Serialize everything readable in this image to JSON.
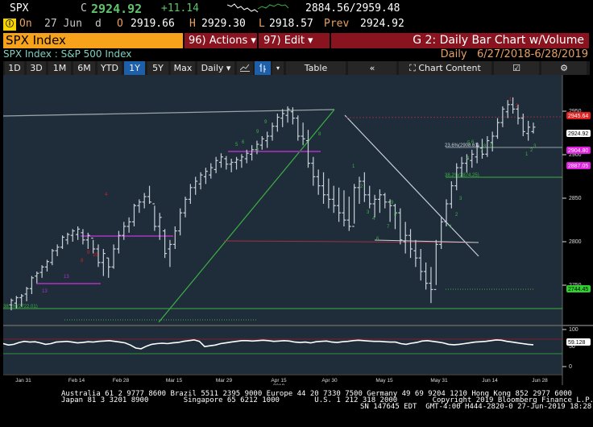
{
  "quote": {
    "ticker": "SPX",
    "close_label": "C",
    "close": "2924.92",
    "change": "+11.14",
    "range_low_high": "2884.56/2959.48",
    "on_label": "On",
    "date": "27 Jun",
    "d_label": "d",
    "open_label": "O",
    "open": "2919.66",
    "high_label": "H",
    "high": "2929.30",
    "low_label": "L",
    "low": "2918.57",
    "prev_label": "Prev",
    "prev": "2924.92",
    "icon": "alert-icon"
  },
  "toolbar_top": {
    "security": "SPX Index",
    "actions": "96) Actions ▾",
    "edit": "97) Edit ▾",
    "title": "G 2: Daily Bar Chart w/Volume"
  },
  "subheader": {
    "description": "SPX Index : S&P 500 Index",
    "period_label": "Daily",
    "range": "6/27/2018-6/28/2019"
  },
  "toolbar": {
    "periods": [
      "1D",
      "3D",
      "1M",
      "6M",
      "YTD",
      "1Y",
      "5Y",
      "Max"
    ],
    "active_period": "1Y",
    "frequency": "Daily ▾",
    "table": "Table",
    "collapse": "«",
    "chart_content": "Chart Content",
    "edit_icon": "edit-icon",
    "settings_icon": "gear-icon"
  },
  "colors": {
    "chart_bg": "#1f2d3a",
    "bars": "#c8d0d8",
    "green": "#3cb043",
    "red": "#d42020",
    "magenta": "#b030c0",
    "orange": "#f7a21b",
    "dark_red": "#8a1320"
  },
  "chart_data": {
    "type": "bar",
    "title": "G 2: Daily Bar Chart w/Volume",
    "series": "SPX Index",
    "ylim": [
      2715,
      2965
    ],
    "y_ticks": [
      "2950",
      "2900",
      "2850",
      "2800",
      "2750"
    ],
    "x_ticks": [
      "Jan 31",
      "Feb 14",
      "Feb 28",
      "Mar 15",
      "Mar 29",
      "Apr 15",
      "Apr 30",
      "May 15",
      "May 31",
      "Jun 14",
      "Jun 28"
    ],
    "x_year": "2019",
    "price_labels": [
      {
        "value": "2945.64",
        "color": "#e02020"
      },
      {
        "value": "2924.92",
        "color": "#ffffff"
      },
      {
        "value": "2904.80",
        "color": "#e020e0"
      },
      {
        "value": "2887.05",
        "color": "#e020e0"
      },
      {
        "value": "2744.45",
        "color": "#30d030"
      }
    ],
    "fib_labels": [
      "23.6%(2908.61)",
      "38.2%(2874.25)",
      "38.2%(2722.01)"
    ],
    "bars": [
      [
        2735,
        2722,
        2728,
        2733
      ],
      [
        2738,
        2724,
        2730,
        2736
      ],
      [
        2740,
        2726,
        2736,
        2738
      ],
      [
        2748,
        2732,
        2740,
        2746
      ],
      [
        2760,
        2740,
        2746,
        2758
      ],
      [
        2765,
        2752,
        2760,
        2763
      ],
      [
        2772,
        2758,
        2764,
        2770
      ],
      [
        2778,
        2765,
        2770,
        2776
      ],
      [
        2790,
        2772,
        2775,
        2788
      ],
      [
        2795,
        2782,
        2788,
        2792
      ],
      [
        2805,
        2790,
        2792,
        2803
      ],
      [
        2808,
        2795,
        2800,
        2806
      ],
      [
        2812,
        2798,
        2805,
        2810
      ],
      [
        2815,
        2800,
        2806,
        2812
      ],
      [
        2812,
        2795,
        2808,
        2800
      ],
      [
        2808,
        2790,
        2800,
        2805
      ],
      [
        2800,
        2785,
        2802,
        2790
      ],
      [
        2795,
        2770,
        2790,
        2775
      ],
      [
        2790,
        2760,
        2775,
        2785
      ],
      [
        2780,
        2758,
        2780,
        2770
      ],
      [
        2795,
        2768,
        2770,
        2790
      ],
      [
        2810,
        2785,
        2790,
        2805
      ],
      [
        2820,
        2800,
        2805,
        2815
      ],
      [
        2825,
        2808,
        2815,
        2820
      ],
      [
        2840,
        2815,
        2820,
        2838
      ],
      [
        2845,
        2830,
        2838,
        2842
      ],
      [
        2852,
        2835,
        2842,
        2848
      ],
      [
        2860,
        2840,
        2848,
        2842
      ],
      [
        2838,
        2810,
        2840,
        2815
      ],
      [
        2830,
        2800,
        2815,
        2825
      ],
      [
        2812,
        2780,
        2810,
        2785
      ],
      [
        2800,
        2770,
        2790,
        2795
      ],
      [
        2815,
        2790,
        2795,
        2810
      ],
      [
        2835,
        2805,
        2810,
        2830
      ],
      [
        2848,
        2825,
        2830,
        2845
      ],
      [
        2862,
        2840,
        2845,
        2858
      ],
      [
        2870,
        2850,
        2858,
        2865
      ],
      [
        2875,
        2856,
        2862,
        2872
      ],
      [
        2880,
        2862,
        2870,
        2876
      ],
      [
        2885,
        2868,
        2872,
        2880
      ],
      [
        2892,
        2874,
        2878,
        2888
      ],
      [
        2896,
        2880,
        2886,
        2892
      ],
      [
        2893,
        2878,
        2890,
        2884
      ],
      [
        2890,
        2875,
        2884,
        2886
      ],
      [
        2892,
        2878,
        2886,
        2889
      ],
      [
        2895,
        2880,
        2888,
        2892
      ],
      [
        2900,
        2885,
        2890,
        2896
      ],
      [
        2905,
        2888,
        2895,
        2900
      ],
      [
        2910,
        2895,
        2900,
        2906
      ],
      [
        2915,
        2900,
        2905,
        2912
      ],
      [
        2920,
        2902,
        2910,
        2915
      ],
      [
        2930,
        2910,
        2915,
        2926
      ],
      [
        2940,
        2920,
        2926,
        2936
      ],
      [
        2945,
        2925,
        2935,
        2940
      ],
      [
        2948,
        2930,
        2938,
        2945
      ],
      [
        2947,
        2928,
        2942,
        2935
      ],
      [
        2938,
        2910,
        2935,
        2915
      ],
      [
        2930,
        2905,
        2915,
        2912
      ],
      [
        2922,
        2880,
        2910,
        2885
      ],
      [
        2892,
        2860,
        2885,
        2870
      ],
      [
        2878,
        2850,
        2870,
        2860
      ],
      [
        2875,
        2840,
        2860,
        2850
      ],
      [
        2868,
        2835,
        2850,
        2845
      ],
      [
        2860,
        2830,
        2845,
        2838
      ],
      [
        2858,
        2820,
        2838,
        2830
      ],
      [
        2855,
        2815,
        2830,
        2822
      ],
      [
        2848,
        2810,
        2822,
        2815
      ],
      [
        2862,
        2818,
        2815,
        2858
      ],
      [
        2870,
        2840,
        2858,
        2865
      ],
      [
        2875,
        2842,
        2865,
        2850
      ],
      [
        2860,
        2835,
        2850,
        2840
      ],
      [
        2850,
        2825,
        2840,
        2845
      ],
      [
        2856,
        2830,
        2845,
        2850
      ],
      [
        2852,
        2835,
        2850,
        2842
      ],
      [
        2845,
        2820,
        2842,
        2838
      ],
      [
        2840,
        2812,
        2838,
        2830
      ],
      [
        2835,
        2795,
        2830,
        2800
      ],
      [
        2820,
        2785,
        2798,
        2805
      ],
      [
        2812,
        2780,
        2805,
        2790
      ],
      [
        2800,
        2770,
        2788,
        2780
      ],
      [
        2790,
        2755,
        2780,
        2765
      ],
      [
        2775,
        2745,
        2765,
        2752
      ],
      [
        2770,
        2730,
        2752,
        2745
      ],
      [
        2800,
        2750,
        2745,
        2795
      ],
      [
        2825,
        2790,
        2795,
        2820
      ],
      [
        2845,
        2815,
        2820,
        2840
      ],
      [
        2865,
        2835,
        2840,
        2860
      ],
      [
        2885,
        2855,
        2860,
        2880
      ],
      [
        2892,
        2870,
        2880,
        2885
      ],
      [
        2895,
        2875,
        2885,
        2890
      ],
      [
        2900,
        2880,
        2888,
        2895
      ],
      [
        2908,
        2885,
        2892,
        2904
      ],
      [
        2912,
        2890,
        2902,
        2895
      ],
      [
        2915,
        2892,
        2895,
        2910
      ],
      [
        2920,
        2898,
        2908,
        2915
      ],
      [
        2935,
        2912,
        2915,
        2930
      ],
      [
        2948,
        2925,
        2930,
        2945
      ],
      [
        2955,
        2935,
        2942,
        2950
      ],
      [
        2958,
        2940,
        2950,
        2945
      ],
      [
        2950,
        2928,
        2945,
        2935
      ],
      [
        2940,
        2915,
        2935,
        2920
      ],
      [
        2932,
        2910,
        2918,
        2925
      ],
      [
        2930,
        2918,
        2920,
        2925
      ]
    ],
    "oscillator": {
      "ylim": [
        0,
        100
      ],
      "y_ticks": [
        "100",
        "50",
        "0"
      ],
      "last_value": "59.128",
      "upper_band": 70,
      "lower_band": 30,
      "values": [
        62,
        58,
        60,
        65,
        68,
        66,
        67,
        64,
        60,
        62,
        66,
        67,
        68,
        66,
        64,
        65,
        67,
        66,
        68,
        69,
        70,
        68,
        66,
        64,
        58,
        50,
        48,
        55,
        60,
        62,
        63,
        62,
        64,
        65,
        68,
        70,
        72,
        68,
        54,
        56,
        58,
        62,
        64,
        66,
        68,
        70,
        70,
        69,
        70,
        71,
        70,
        68,
        69,
        70,
        69,
        66,
        65,
        66,
        64,
        67,
        68,
        69,
        66,
        65,
        67,
        68,
        70,
        71,
        70,
        69,
        68,
        68,
        67,
        66,
        66,
        62,
        60,
        63,
        65,
        69,
        70,
        68,
        66,
        64,
        60,
        59,
        60,
        62,
        64,
        66,
        67,
        68,
        70,
        72,
        71,
        68,
        66,
        64,
        62,
        60,
        59
      ]
    }
  },
  "footer": {
    "line1": "Australia 61 2 9777 8600 Brazil 5511 2395 9000 Europe 44 20 7330 7500 Germany 49 69 9204 1210 Hong Kong 852 2977 6000",
    "line2": "Japan 81 3 3201 8900        Singapore 65 6212 1000        U.S. 1 212 318 2000        Copyright 2019 Bloomberg Finance L.P.",
    "line3": "SN 147645 EDT  GMT-4:00 H444-2820-0 27-Jun-2019 18:28:42"
  }
}
